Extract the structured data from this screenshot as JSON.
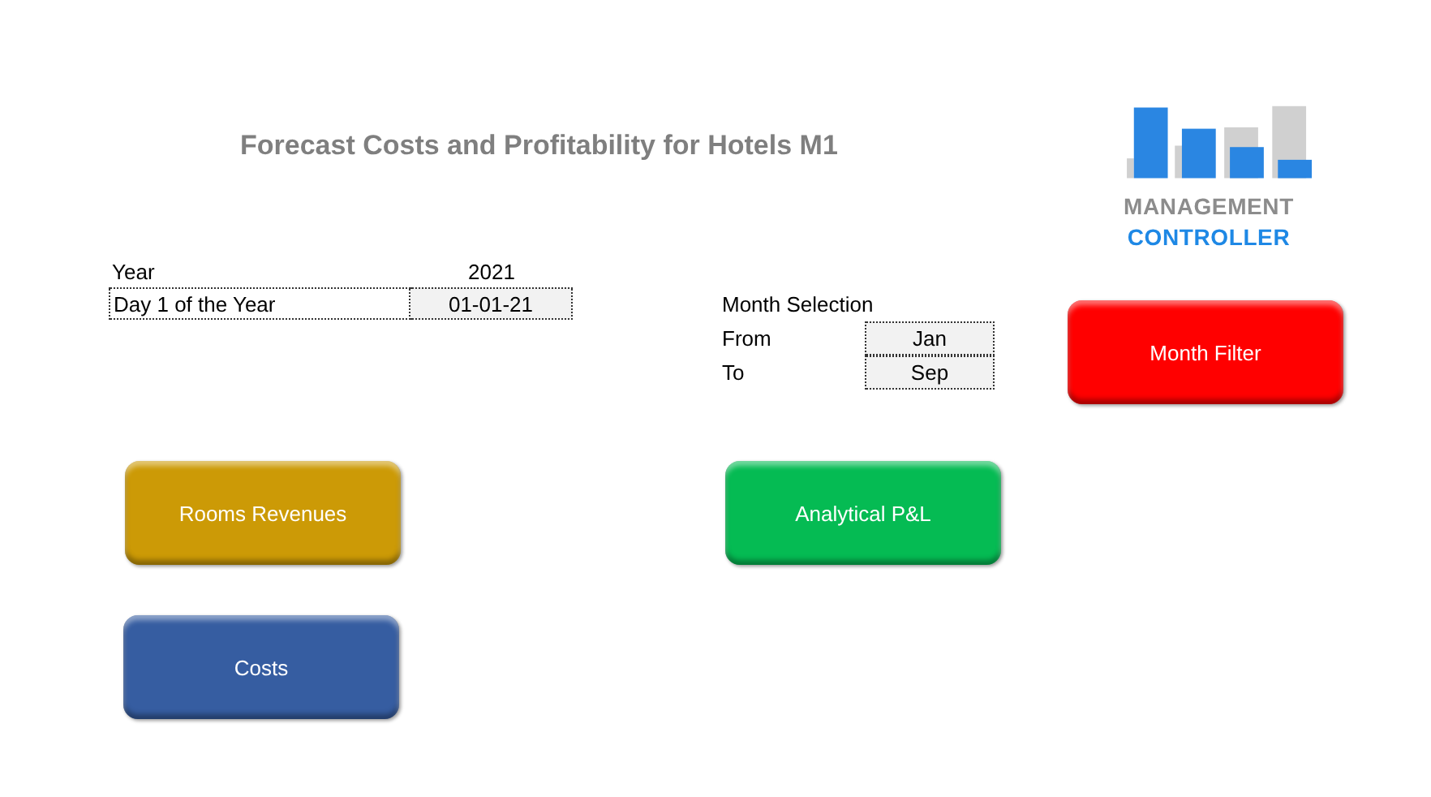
{
  "title": "Forecast Costs and Profitability for Hotels M1",
  "logo": {
    "line_1": "MANAGEMENT",
    "line_2": "CONTROLLER"
  },
  "year_table": [
    {
      "label": "Year",
      "value": "2021",
      "boxed": false
    },
    {
      "label": "Day 1 of the Year",
      "value": "01-01-21",
      "boxed": true
    }
  ],
  "month_selection": {
    "title": "Month Selection",
    "rows": [
      {
        "label": "From",
        "value": "Jan"
      },
      {
        "label": "To",
        "value": "Sep"
      }
    ]
  },
  "filter_button": {
    "label": "Month Filter",
    "color": "#ff0000"
  },
  "buttons": [
    {
      "label": "Rooms Revenues",
      "color": "#cc9a06"
    },
    {
      "label": "Analytical P&L",
      "color": "#05bb53"
    },
    {
      "label": "Costs",
      "color": "#365da1"
    }
  ]
}
